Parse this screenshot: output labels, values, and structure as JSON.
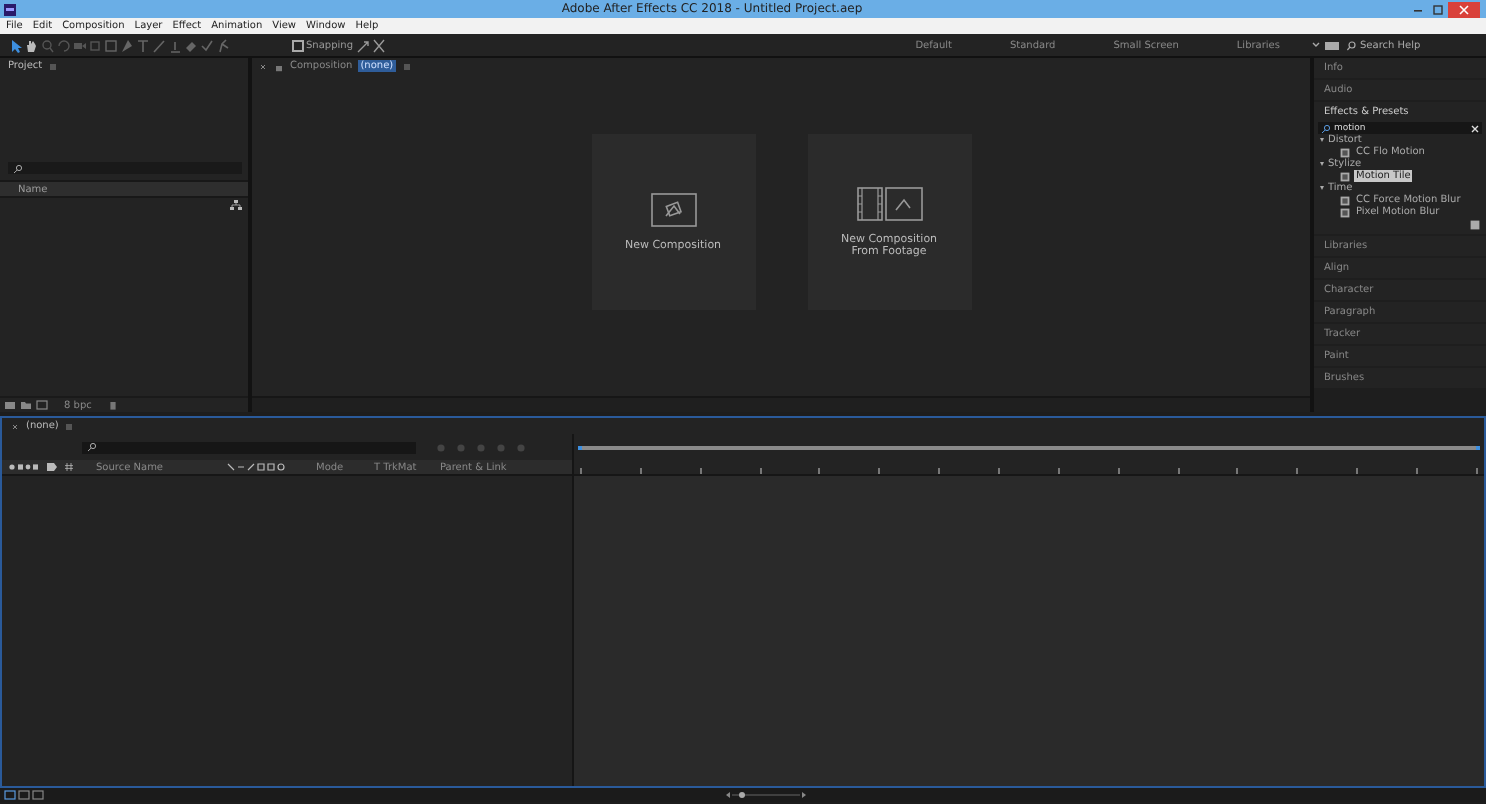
{
  "window": {
    "title": "Adobe After Effects CC 2018 - Untitled Project.aep"
  },
  "menu": [
    "File",
    "Edit",
    "Composition",
    "Layer",
    "Effect",
    "Animation",
    "View",
    "Window",
    "Help"
  ],
  "toolbar": {
    "snapping": {
      "label": "Snapping",
      "checked": false
    },
    "workspaces": [
      {
        "label": "Default",
        "selected": false
      },
      {
        "label": "Standard",
        "selected": false
      },
      {
        "label": "Small Screen",
        "selected": false
      },
      {
        "label": "Libraries",
        "selected": false
      }
    ],
    "search": {
      "placeholder": "Search Help"
    }
  },
  "project": {
    "title": "Project",
    "column": "Name",
    "bpc": "8 bpc"
  },
  "composition": {
    "title": "Composition",
    "tag": "(none)",
    "cards": [
      {
        "kind": "comp",
        "label": "New Composition"
      },
      {
        "kind": "footage",
        "label": "New Composition From Footage"
      }
    ]
  },
  "panels": [
    {
      "label": "Info",
      "expanded": false
    },
    {
      "label": "Audio",
      "expanded": false
    },
    {
      "label": "Effects & Presets",
      "expanded": true,
      "search": "motion",
      "tree": [
        {
          "label": "Distort",
          "expanded": true,
          "children": [
            {
              "label": "CC Flo Motion",
              "selected": false
            }
          ]
        },
        {
          "label": "Stylize",
          "expanded": true,
          "children": [
            {
              "label": "Motion Tile",
              "selected": true
            }
          ]
        },
        {
          "label": "Time",
          "expanded": true,
          "children": [
            {
              "label": "CC Force Motion Blur",
              "selected": false
            },
            {
              "label": "Pixel Motion Blur",
              "selected": false
            }
          ]
        }
      ]
    },
    {
      "label": "Libraries",
      "expanded": false
    },
    {
      "label": "Align",
      "expanded": false
    },
    {
      "label": "Character",
      "expanded": false
    },
    {
      "label": "Paragraph",
      "expanded": false
    },
    {
      "label": "Tracker",
      "expanded": false
    },
    {
      "label": "Paint",
      "expanded": false
    },
    {
      "label": "Brushes",
      "expanded": false
    }
  ],
  "timeline": {
    "tab": "(none)",
    "columns": [
      "Source Name",
      "Mode",
      "T TrkMat",
      "Parent & Link"
    ]
  }
}
